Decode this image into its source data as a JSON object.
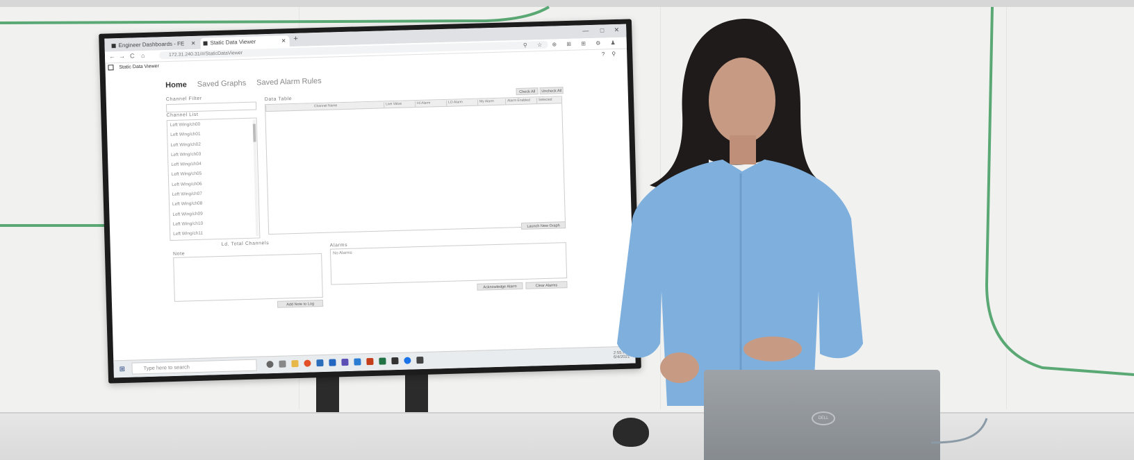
{
  "browser": {
    "tabs": [
      {
        "label": "Engineer Dashboards - FE"
      },
      {
        "label": "Static Data Viewer"
      }
    ],
    "new_tab": "+",
    "url": "172.31.240.31/#/StaticDataViewer",
    "nav": {
      "back": "←",
      "forward": "→",
      "reload": "C",
      "home": "⌂"
    },
    "window_controls": {
      "minimize": "—",
      "maximize": "□",
      "close": "✕"
    }
  },
  "app": {
    "title": "Static Data Viewer",
    "help": "?",
    "account": "⚲",
    "nav": {
      "home": "Home",
      "saved_graphs": "Saved Graphs",
      "saved_alarm_rules": "Saved Alarm Rules"
    },
    "channel_filter_label": "Channel Filter",
    "channel_list_label": "Channel List",
    "channels": [
      "Left Wing/ch00",
      "Left Wing/ch01",
      "Left Wing/ch02",
      "Left Wing/ch03",
      "Left Wing/ch04",
      "Left Wing/ch05",
      "Left Wing/ch06",
      "Left Wing/ch07",
      "Left Wing/ch08",
      "Left Wing/ch09",
      "Left Wing/ch10",
      "Left Wing/ch11"
    ],
    "total_channels": "Ld. Total Channels",
    "data_table_label": "Data Table",
    "check_all": "Check All",
    "uncheck_all": "Uncheck All",
    "columns": [
      "Channel Name",
      "Live Value",
      "HI Alarm",
      "LO Alarm",
      "My Alarm",
      "Alarm Enabled",
      "Selected"
    ],
    "launch_graph": "Launch New Graph",
    "note_label": "Note",
    "add_note": "Add Note to Log",
    "alarms_label": "Alarms",
    "alarms_text": "No Alarms",
    "acknowledge_alarm": "Acknowledge Alarm",
    "clear_alarms": "Clear Alarms"
  },
  "taskbar": {
    "search_placeholder": "Type here to search",
    "tray_time": "2:55 PM",
    "tray_date": "6/4/2021"
  },
  "laptop": {
    "logo": "DELL"
  },
  "colors": {
    "wall_accent": "#5aa874",
    "blouse": "#7fb0dd",
    "laptop": "#92979c"
  }
}
